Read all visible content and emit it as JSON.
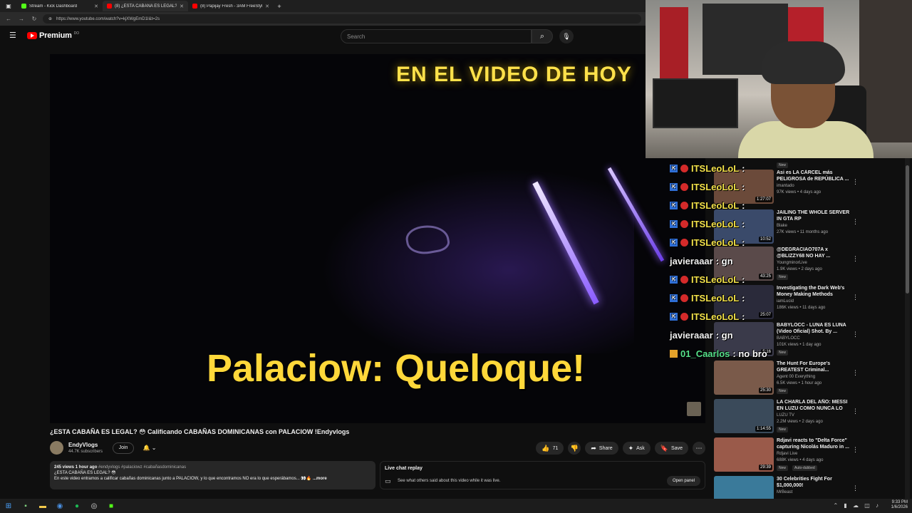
{
  "browser": {
    "tabs": [
      {
        "title": "Stream - Kick Dashboard",
        "active": false,
        "favicon_color": "#53fc18"
      },
      {
        "title": "(8) ¿ESTA CABAÑA ES LEGAL? 😳",
        "active": true,
        "favicon_color": "#ff0000"
      },
      {
        "title": "(8) Papijay Fresh - 3AM FreeStyle",
        "active": false,
        "favicon_color": "#ff0000"
      }
    ],
    "url": "https://www.youtube.com/watch?v=kjXWgEmD1I&t=2s",
    "new_tab": "+"
  },
  "youtube": {
    "logo_text": "Premium",
    "logo_sup": "DO",
    "search_placeholder": "Search",
    "search_icon": "search-icon",
    "mic_icon": "mic-icon"
  },
  "player": {
    "overlay_top": "EN EL VIDEO DE HOY",
    "overlay_bottom": "Palaciow: Queloque!"
  },
  "chat": [
    {
      "user": "ITSLeoLoL",
      "msg": ":",
      "color": "yellow",
      "badges": [
        "k",
        "r"
      ]
    },
    {
      "user": "ITSLeoLoL",
      "msg": ":",
      "color": "yellow",
      "badges": [
        "k",
        "r"
      ]
    },
    {
      "user": "ITSLeoLoL",
      "msg": ":",
      "color": "yellow",
      "badges": [
        "k",
        "r"
      ]
    },
    {
      "user": "ITSLeoLoL",
      "msg": ":",
      "color": "yellow",
      "badges": [
        "k",
        "r"
      ]
    },
    {
      "user": "ITSLeoLoL",
      "msg": ":",
      "color": "yellow",
      "badges": [
        "k",
        "r"
      ]
    },
    {
      "user": "javieraaar",
      "msg": ": gn",
      "color": "white",
      "badges": []
    },
    {
      "user": "ITSLeoLoL",
      "msg": ":",
      "color": "yellow",
      "badges": [
        "k",
        "r"
      ]
    },
    {
      "user": "ITSLeoLoL",
      "msg": ":",
      "color": "yellow",
      "badges": [
        "k",
        "r"
      ]
    },
    {
      "user": "ITSLeoLoL",
      "msg": ":",
      "color": "yellow",
      "badges": [
        "k",
        "r"
      ]
    },
    {
      "user": "javieraaar",
      "msg": ": gn",
      "color": "white",
      "badges": []
    },
    {
      "user": "01_Caarlos",
      "msg": ": no bro",
      "color": "green",
      "badges": [
        "c"
      ]
    }
  ],
  "recommendations": [
    {
      "title": "Asi es LA CÁRCEL más PELIGROSA de REPÚBLICA ...",
      "channel": "imantado",
      "meta": "97K views • 4 days ago",
      "duration": "1:27:07",
      "badge": "New",
      "thumb_color": "#6b4a3a"
    },
    {
      "title": "JAILING THE WHOLE SERVER IN GTA RP",
      "channel": "Blake",
      "meta": "27K views • 11 months ago",
      "duration": "10:52",
      "badge": "",
      "thumb_color": "#3a4a6a"
    },
    {
      "title": "@DEGRACIAO707A x @BLIZZY68 NO HAY ...",
      "channel": "YoungminorLive",
      "meta": "1.9K views • 2 days ago",
      "duration": "43:25",
      "badge": "New",
      "thumb_color": "#5a4a4a"
    },
    {
      "title": "Investigating the Dark Web's Money Making Methods",
      "channel": "iamLucid",
      "meta": "186K views • 11 days ago",
      "duration": "25:07",
      "badge": "",
      "thumb_color": "#2a2a3a"
    },
    {
      "title": "BABYLOCC - LUNA ES LUNA (Video Oficial) Shot. By ...",
      "channel": "BABYLOCC",
      "meta": "101K views • 1 day ago",
      "duration": "5:16",
      "badge": "New",
      "thumb_color": "#3a3a4a"
    },
    {
      "title": "The Hunt For Europe's GREATEST Criminal...",
      "channel": "Agent 00 Everything",
      "meta": "6.5K views • 1 hour ago",
      "duration": "25:30",
      "badge": "New",
      "thumb_color": "#7a5a4a"
    },
    {
      "title": "LA CHARLA DEL AÑO: MESSI EN LUZU COMO NUNCA LO VISTE",
      "channel": "LUZU TV",
      "meta": "2.2M views • 2 days ago",
      "duration": "1:14:55",
      "badge": "New",
      "thumb_color": "#3a4a5a"
    },
    {
      "title": "Rdjavi reacts to \"Delta Force\" capturing Nicolás Maduro in ...",
      "channel": "Rdjavi Live",
      "meta": "688K views • 4 days ago",
      "duration": "29:39",
      "badge": "New",
      "badge2": "Auto-dubbed",
      "thumb_color": "#9a5a4a"
    },
    {
      "title": "30 Celebrities Fight For $1,000,000!",
      "channel": "MrBeast",
      "meta": "",
      "duration": "",
      "badge": "",
      "thumb_color": "#3a7a9a"
    }
  ],
  "video": {
    "title": "¿ESTA CABAÑA ES LEGAL? 😳 Calificando CABAÑAS DOMINICANAS con PALACIOW !Endyvlogs",
    "channel": "EndyVlogs",
    "subscribers": "44.7K subscribers",
    "join_label": "Join",
    "likes": "71",
    "share_label": "Share",
    "ask_label": "Ask",
    "save_label": "Save",
    "stats": "245 views 1 hour ago",
    "tags": "#endyvlogs #palaciowz #cabañasdominicanas",
    "desc_line1": "¿ESTA CABAÑA ES LEGAL? 😳",
    "desc_line2": "En este video entramos a calificar cabañas dominicanas junto a PALACIOW, y lo que encontramos NO era lo que esperábamos... 👀🔥",
    "more_label": "...more"
  },
  "live_chat": {
    "title": "Live chat replay",
    "subtitle": "See what others said about this video while it was live.",
    "button": "Open panel"
  },
  "taskbar": {
    "time": "9:33 PM",
    "date": "1/6/2026"
  }
}
